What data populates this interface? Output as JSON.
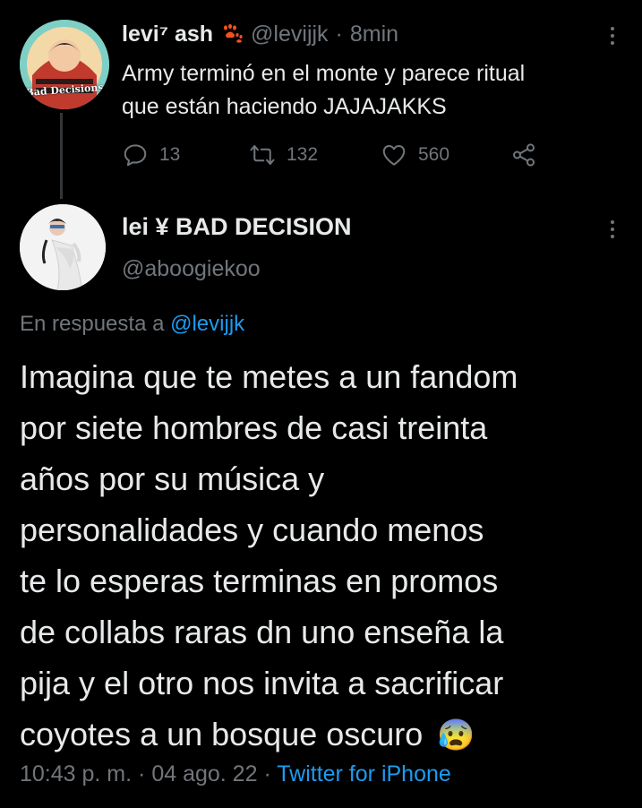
{
  "parent_tweet": {
    "avatar_text": "Bad Decisions",
    "display_name": "levi⁷ ash",
    "paw_icon": "paw-prints-icon",
    "handle": "@levijjk",
    "separator": "·",
    "time": "8min",
    "text_line1": "Army terminó en el monte y parece ritual",
    "text_line2": "que están haciendo JAJAJAKKS",
    "actions": {
      "replies": "13",
      "retweets": "132",
      "likes": "560"
    }
  },
  "main_tweet": {
    "display_name": "lei ¥ BAD DECISION",
    "handle": "@aboogiekoo",
    "reply_prefix": "En respuesta a",
    "reply_to": "@levijjk",
    "text_lines": [
      "Imagina que te metes a un fandom",
      "por siete hombres de casi treinta",
      "años por su música y",
      "personalidades y cuando menos",
      "te lo esperas terminas en promos",
      "de collabs raras dn uno enseña la",
      "pija y el otro nos invita a sacrificar",
      "coyotes a un bosque oscuro"
    ],
    "emoji": "😰",
    "meta": {
      "time": "10:43 p. m.",
      "sep1": "·",
      "date": "04 ago. 22",
      "sep2": "·",
      "source": "Twitter for iPhone"
    }
  },
  "colors": {
    "background": "#000000",
    "text": "#e7e9ea",
    "muted": "#71767b",
    "link": "#1d9bf0",
    "thread_line": "#333639"
  }
}
